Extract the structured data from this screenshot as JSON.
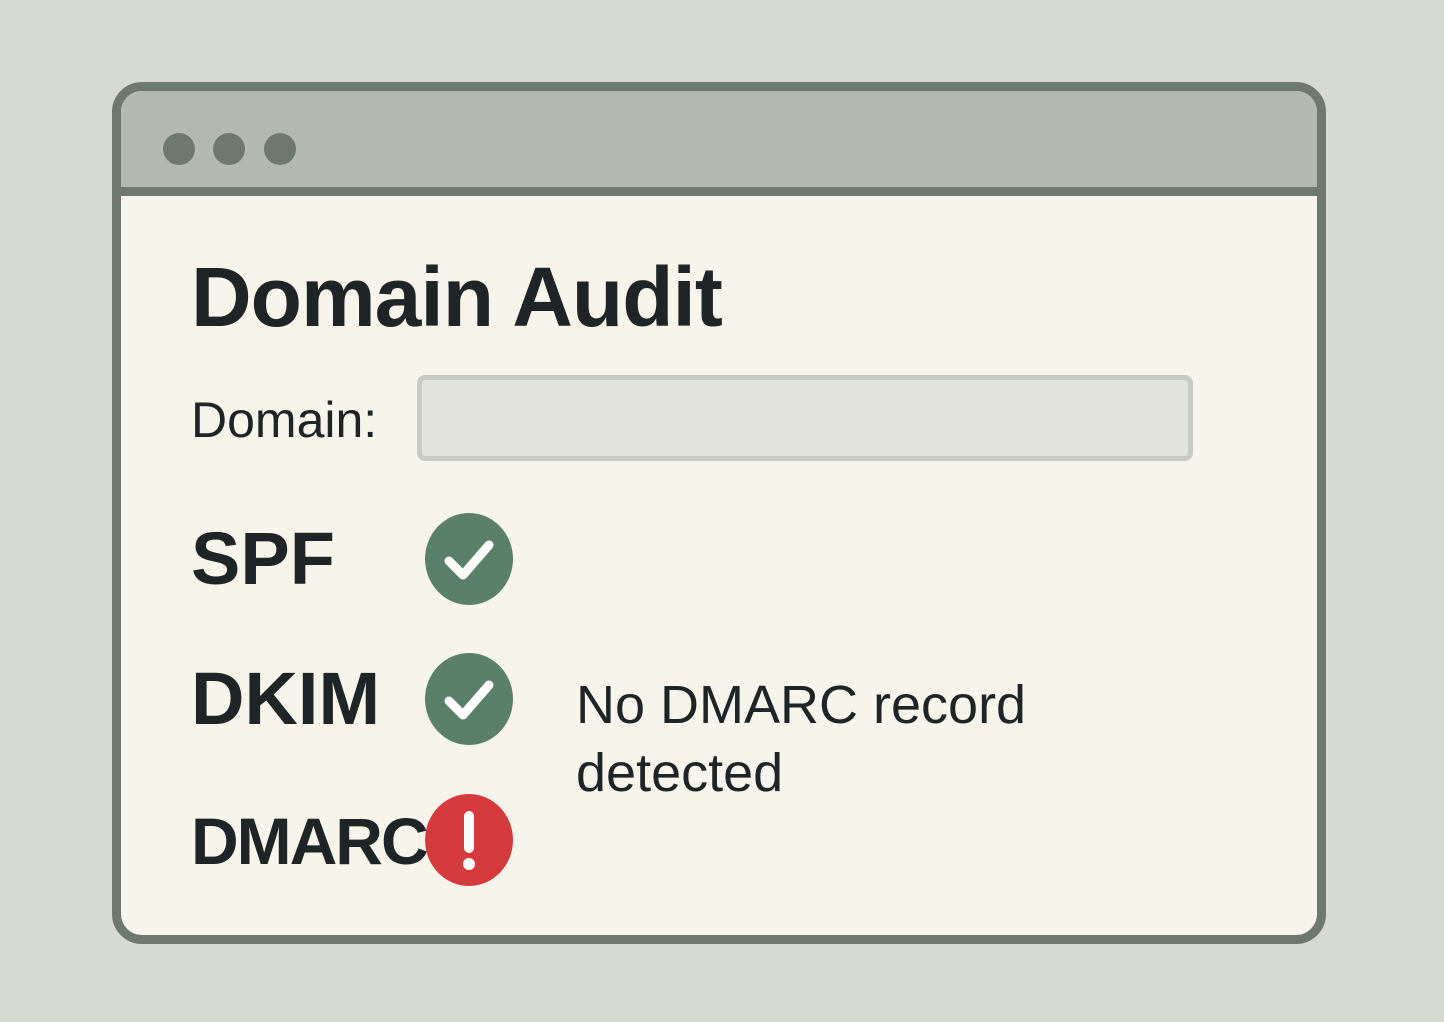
{
  "app": {
    "title": "Domain Audit"
  },
  "form": {
    "domain_label": "Domain:",
    "domain_value": "",
    "domain_placeholder": ""
  },
  "checks": [
    {
      "label": "SPF",
      "status": "pass",
      "icon": "check-circle-icon",
      "color": "#5a8069"
    },
    {
      "label": "DKIM",
      "status": "pass",
      "icon": "check-circle-icon",
      "color": "#5a8069"
    },
    {
      "label": "DMARC",
      "status": "fail",
      "icon": "exclamation-circle-icon",
      "color": "#d53a3d"
    }
  ],
  "message": "No DMARC record detected",
  "colors": {
    "background": "#d6d9d1",
    "window_border": "#6f786f",
    "titlebar": "#b3b9b0",
    "content": "#f7f4ec",
    "pass": "#5a8069",
    "fail": "#d53a3d"
  }
}
